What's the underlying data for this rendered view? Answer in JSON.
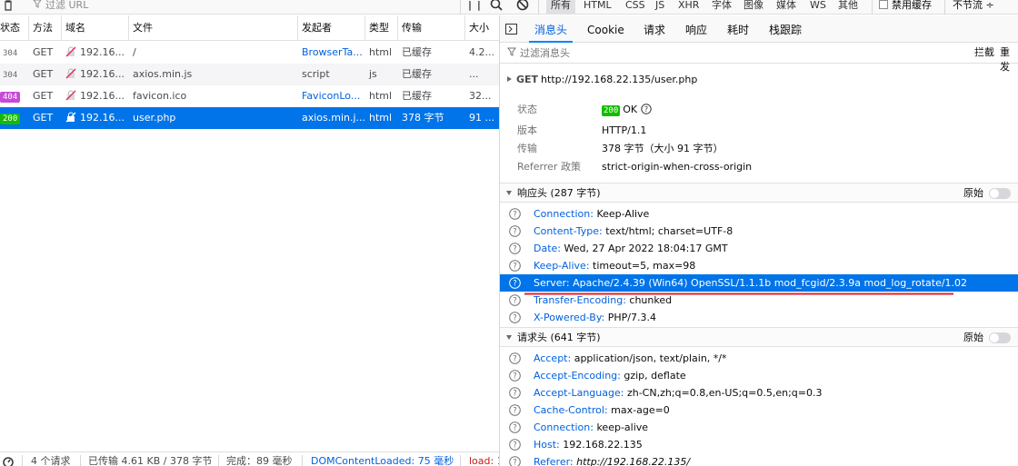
{
  "toolbar": {
    "filter_placeholder": "过滤 URL",
    "pause_glyph": "| |",
    "type_filters": [
      {
        "label": "所有",
        "active": true
      },
      {
        "label": "HTML"
      },
      {
        "label": "CSS"
      },
      {
        "label": "JS"
      },
      {
        "label": "XHR"
      },
      {
        "label": "字体"
      },
      {
        "label": "图像"
      },
      {
        "label": "媒体"
      },
      {
        "label": "WS"
      },
      {
        "label": "其他"
      }
    ],
    "disable_cache_label": "禁用缓存",
    "throttle_label": "不节流 ÷"
  },
  "table": {
    "columns": [
      "状态",
      "方法",
      "域名",
      "文件",
      "发起者",
      "类型",
      "传输",
      "大小"
    ],
    "rows": [
      {
        "status": "304",
        "method": "GET",
        "domain": "192.16...",
        "file": "/",
        "initiator": "BrowserTa...",
        "initiator_link": true,
        "type": "html",
        "transfer": "已缓存",
        "size": "4.2..."
      },
      {
        "status": "304",
        "method": "GET",
        "domain": "192.16...",
        "file": "axios.min.js",
        "initiator": "script",
        "initiator_link": false,
        "type": "js",
        "transfer": "已缓存",
        "size": "..."
      },
      {
        "status": "404",
        "method": "GET",
        "domain": "192.16...",
        "file": "favicon.ico",
        "initiator": "FaviconLo...",
        "initiator_link": true,
        "type": "html",
        "transfer": "已缓存",
        "size": "32..."
      },
      {
        "status": "200",
        "method": "GET",
        "domain": "192.16...",
        "file": "user.php",
        "initiator": "axios.min.j...",
        "initiator_link": true,
        "type": "html",
        "transfer": "378 字节",
        "size": "91 ...",
        "selected": true
      }
    ]
  },
  "statusbar": {
    "requests": "4 个请求",
    "transferred": "已传输 4.61 KB / 378 字节",
    "finish": "完成：89 毫秒",
    "dom_loaded": "DOMContentLoaded: 75 毫秒",
    "load": "load: 1"
  },
  "details": {
    "tabs": [
      "消息头",
      "Cookie",
      "请求",
      "响应",
      "耗时",
      "栈跟踪"
    ],
    "active_tab": "消息头",
    "filter_placeholder": "过滤消息头",
    "block_label": "拦截",
    "resend_label": "重发",
    "summary": {
      "method": "GET",
      "url": "http://192.168.22.135/user.php"
    },
    "info": [
      {
        "label": "状态",
        "code": "200",
        "text": "OK"
      },
      {
        "label": "版本",
        "value": "HTTP/1.1"
      },
      {
        "label": "传输",
        "value": "378 字节（大小 91 字节）"
      },
      {
        "label": "Referrer 政策",
        "value": "strict-origin-when-cross-origin"
      }
    ],
    "response_section": {
      "title": "响应头 (287 字节)",
      "raw_label": "原始"
    },
    "response_headers": [
      {
        "name": "Connection:",
        "value": "Keep-Alive"
      },
      {
        "name": "Content-Type:",
        "value": "text/html; charset=UTF-8"
      },
      {
        "name": "Date:",
        "value": "Wed, 27 Apr 2022 18:04:17 GMT"
      },
      {
        "name": "Keep-Alive:",
        "value": "timeout=5, max=98"
      },
      {
        "name": "Server:",
        "value": "Apache/2.4.39 (Win64) OpenSSL/1.1.1b mod_fcgid/2.3.9a mod_log_rotate/1.02",
        "highlight": true
      },
      {
        "name": "Transfer-Encoding:",
        "value": "chunked"
      },
      {
        "name": "X-Powered-By:",
        "value": "PHP/7.3.4"
      }
    ],
    "request_section": {
      "title": "请求头 (641 字节)",
      "raw_label": "原始"
    },
    "request_headers": [
      {
        "name": "Accept:",
        "value": "application/json, text/plain, */*"
      },
      {
        "name": "Accept-Encoding:",
        "value": "gzip, deflate"
      },
      {
        "name": "Accept-Language:",
        "value": "zh-CN,zh;q=0.8,en-US;q=0.5,en;q=0.3"
      },
      {
        "name": "Cache-Control:",
        "value": "max-age=0"
      },
      {
        "name": "Connection:",
        "value": "keep-alive"
      },
      {
        "name": "Host:",
        "value": "192.168.22.135"
      },
      {
        "name": "Referer:",
        "value": "http://192.168.22.135/",
        "italic": true
      }
    ]
  },
  "colors": {
    "accent": "#0060df",
    "selected": "#0074e8",
    "status_ok": "#12bc00",
    "status_404": "#c54bd6",
    "annotation": "#e0202a"
  }
}
